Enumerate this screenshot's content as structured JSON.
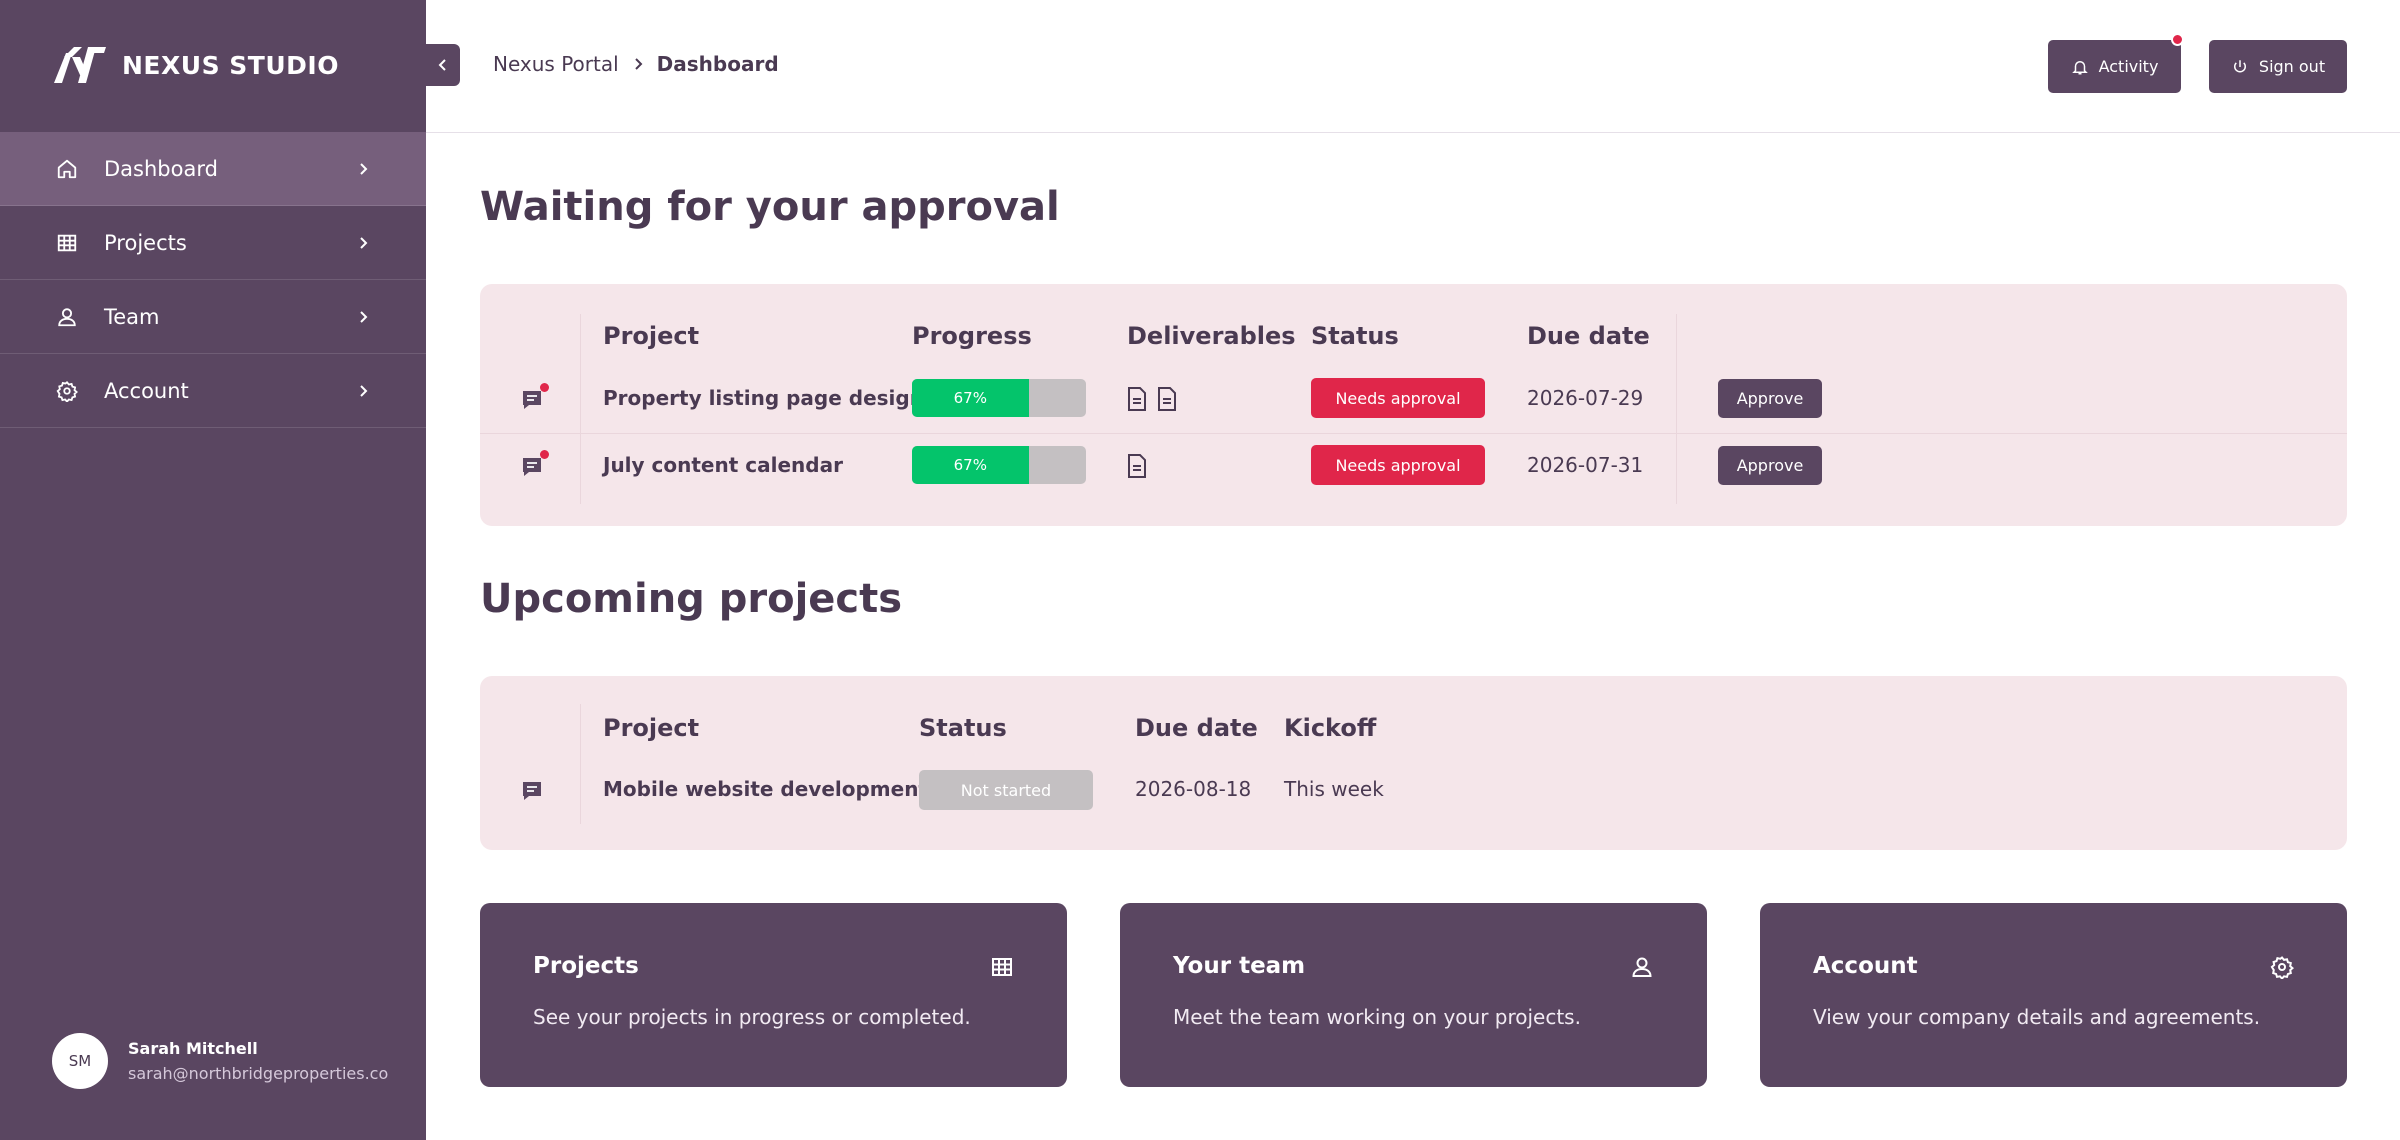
{
  "brand": {
    "name": "NEXUS STUDIO"
  },
  "sidebar": {
    "items": [
      {
        "label": "Dashboard",
        "icon": "home-icon",
        "active": true
      },
      {
        "label": "Projects",
        "icon": "grid-icon"
      },
      {
        "label": "Team",
        "icon": "user-icon"
      },
      {
        "label": "Account",
        "icon": "gear-icon"
      }
    ],
    "user": {
      "initials": "SM",
      "name": "Sarah Mitchell",
      "email": "sarah@northbridgeproperties.co"
    }
  },
  "header": {
    "breadcrumb_home": "Nexus Portal",
    "breadcrumb_current": "Dashboard",
    "activity_label": "Activity",
    "signout_label": "Sign out"
  },
  "approval": {
    "title": "Waiting for your approval",
    "columns": {
      "project": "Project",
      "progress": "Progress",
      "deliverables": "Deliverables",
      "status": "Status",
      "due": "Due date"
    },
    "rows": [
      {
        "project": "Property listing page design",
        "progress_label": "67%",
        "progress": 0.67,
        "deliverables": 2,
        "status": "Needs approval",
        "due": "2026-07-29",
        "action": "Approve"
      },
      {
        "project": "July content calendar",
        "progress_label": "67%",
        "progress": 0.67,
        "deliverables": 1,
        "status": "Needs approval",
        "due": "2026-07-31",
        "action": "Approve"
      }
    ]
  },
  "upcoming": {
    "title": "Upcoming projects",
    "columns": {
      "project": "Project",
      "status": "Status",
      "due": "Due date",
      "kickoff": "Kickoff"
    },
    "rows": [
      {
        "project": "Mobile website development",
        "status": "Not started",
        "due": "2026-08-18",
        "kickoff": "This week"
      }
    ]
  },
  "cards": [
    {
      "title": "Projects",
      "desc": "See your projects in progress or completed.",
      "icon": "grid-icon"
    },
    {
      "title": "Your team",
      "desc": "Meet the team working on your projects.",
      "icon": "user-icon"
    },
    {
      "title": "Account",
      "desc": "View your company details and agreements.",
      "icon": "gear-icon"
    }
  ],
  "colors": {
    "sidebar": "#5a4661",
    "accent_red": "#e0264a",
    "progress_green": "#04c46b",
    "panel": "#f5e6ea"
  }
}
